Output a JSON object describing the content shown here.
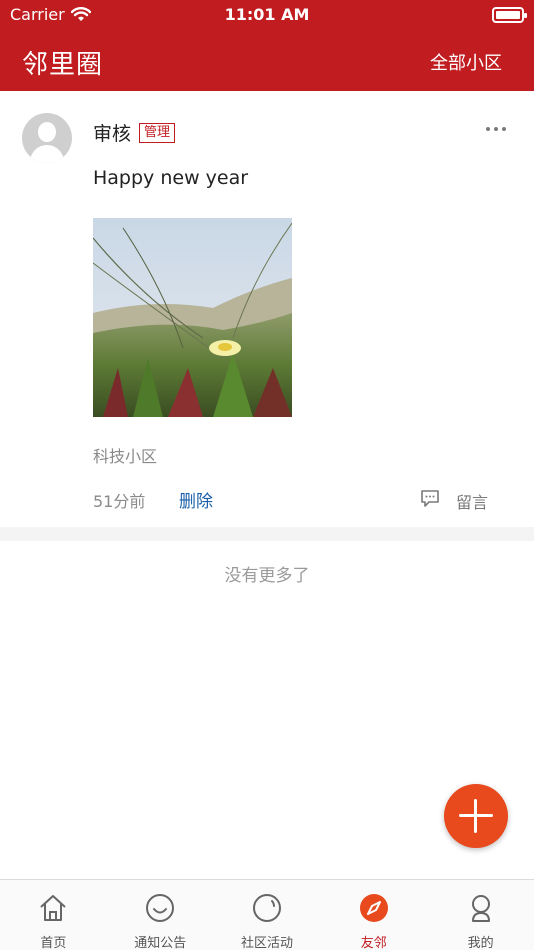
{
  "status_bar": {
    "carrier": "Carrier",
    "time": "11:01 AM"
  },
  "nav": {
    "title": "邻里圈",
    "right_action": "全部小区"
  },
  "post": {
    "author": "审核",
    "badge": "管理",
    "text": "Happy new year",
    "community": "科技小区",
    "time_ago": "51分前",
    "delete_label": "删除",
    "comment_label": "留言"
  },
  "footer_note": "没有更多了",
  "tabs": [
    {
      "label": "首页",
      "icon": "home-icon",
      "active": false
    },
    {
      "label": "通知公告",
      "icon": "smile-icon",
      "active": false
    },
    {
      "label": "社区活动",
      "icon": "refresh-circle-icon",
      "active": false
    },
    {
      "label": "友邻",
      "icon": "compass-icon",
      "active": true
    },
    {
      "label": "我的",
      "icon": "user-icon",
      "active": false
    }
  ],
  "colors": {
    "brand_red": "#c11c20",
    "fab_orange": "#e8491d",
    "link_blue": "#1a5fa8"
  }
}
